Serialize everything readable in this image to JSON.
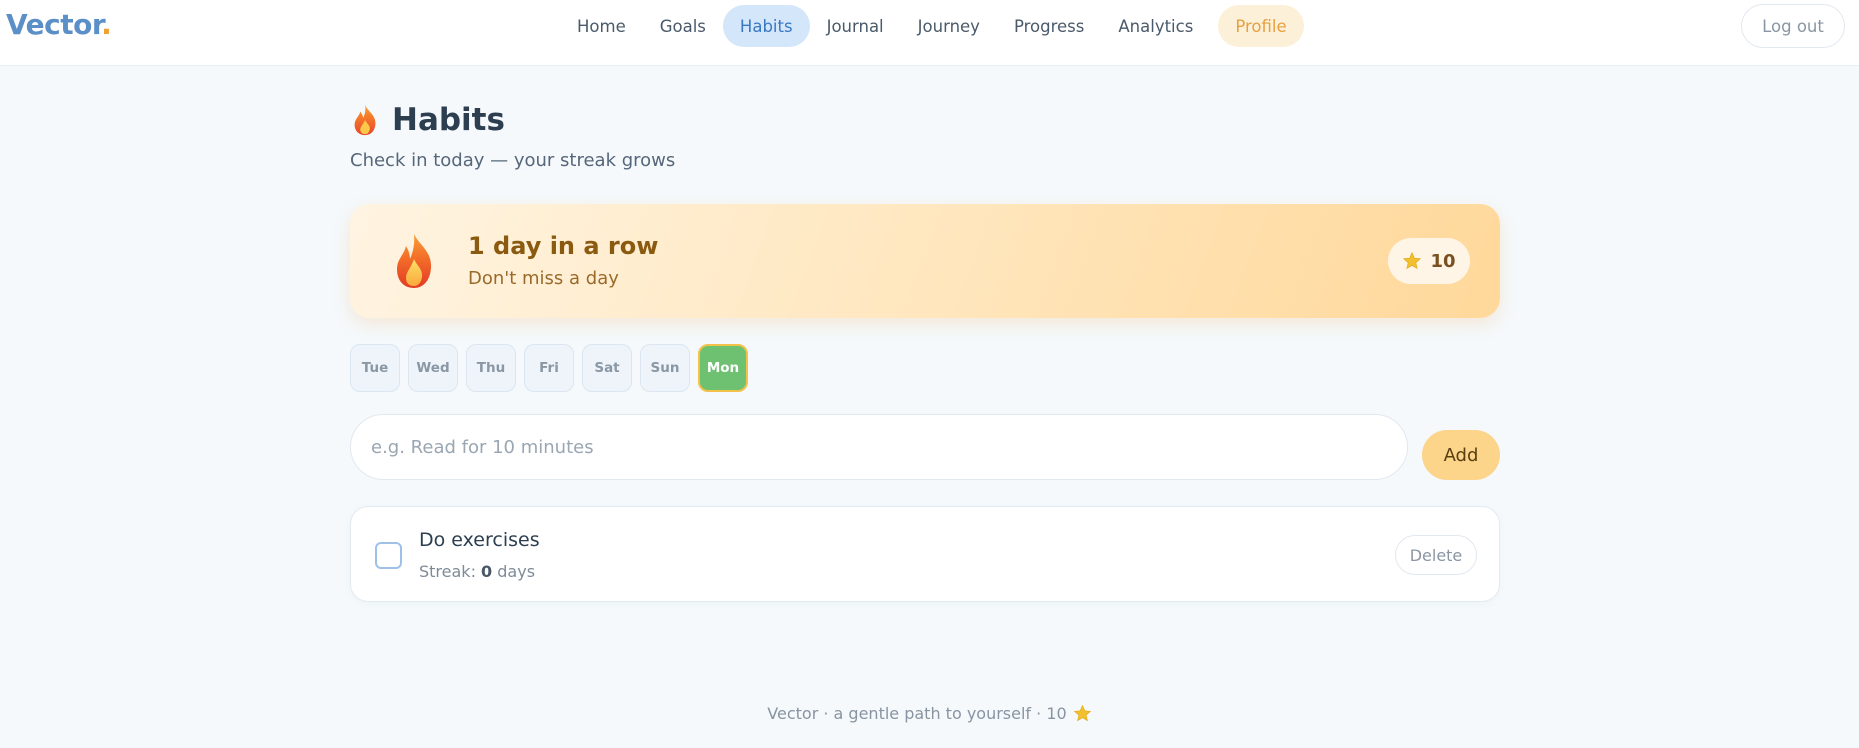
{
  "app": {
    "logo": "Vector",
    "logo_dot": "."
  },
  "nav": {
    "items": [
      {
        "label": "Home"
      },
      {
        "label": "Goals"
      },
      {
        "label": "Habits"
      },
      {
        "label": "Journal"
      },
      {
        "label": "Journey"
      },
      {
        "label": "Progress"
      },
      {
        "label": "Analytics"
      },
      {
        "label": "Profile"
      }
    ],
    "active": "Habits",
    "logout_label": "Log out"
  },
  "page": {
    "title": "Habits",
    "title_icon": "flame-icon",
    "subtitle": "Check in today — your streak grows"
  },
  "streak": {
    "title": "1 day in a row",
    "subtitle": "Don't miss a day",
    "icon": "flame-icon",
    "points": "10",
    "points_icon": "star-icon"
  },
  "days": {
    "items": [
      "Tue",
      "Wed",
      "Thu",
      "Fri",
      "Sat",
      "Sun",
      "Mon"
    ],
    "today": "Mon"
  },
  "new_habit": {
    "placeholder": "e.g. Read for 10 minutes",
    "value": "",
    "add_label": "Add"
  },
  "habits": [
    {
      "name": "Do exercises",
      "streak_prefix": "Streak: ",
      "streak_count": "0",
      "streak_suffix": " days",
      "checked": false,
      "delete_label": "Delete"
    }
  ],
  "footer": {
    "text": "Vector · a gentle path to yourself · 10",
    "icon": "star-icon"
  },
  "colors": {
    "brand": "#5b8fc7",
    "accent": "#f0a030",
    "active_tab_bg": "#d3e6fa",
    "today_green": "#6fc172",
    "add_button": "#fcd48a"
  }
}
